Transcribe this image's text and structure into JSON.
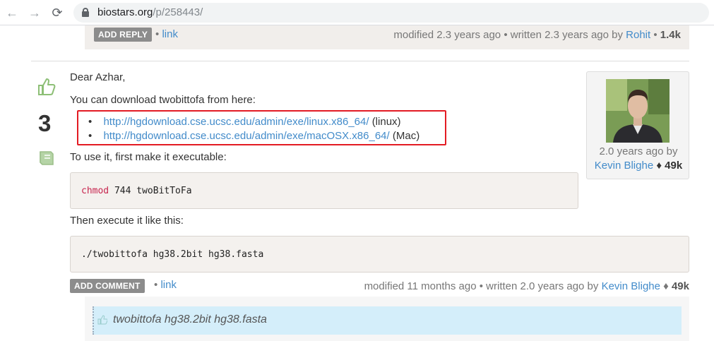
{
  "browser": {
    "url_domain": "biostars.org",
    "url_path": "/p/258443/",
    "back_glyph": "←",
    "forward_glyph": "→",
    "reload_glyph": "⟳"
  },
  "top_reply": {
    "button_label": "ADD REPLY",
    "separator": "•",
    "link_label": "link",
    "modified": "modified 2.3 years ago",
    "written": "• written 2.3 years ago by",
    "author": "Rohit",
    "score": "1.4k",
    "score_sep": "•"
  },
  "answer": {
    "votes": "3",
    "greeting": "Dear Azhar,",
    "intro": "You can download twobittofa from here:",
    "links": [
      {
        "url": "http://hgdownload.cse.ucsc.edu/admin/exe/linux.x86_64/",
        "note": "(linux)"
      },
      {
        "url": "http://hgdownload.cse.ucsc.edu/admin/exe/macOSX.x86_64/",
        "note": "(Mac)"
      }
    ],
    "step1": "To use it, first make it executable:",
    "code1_cmd": "chmod",
    "code1_rest": " 744 twoBitToFa",
    "step2": "Then execute it like this:",
    "code2": "./twobittofa hg38.2bit hg38.fasta",
    "author_card": {
      "ago": "2.0 years ago by",
      "name": "Kevin Blighe",
      "diamond": "♦",
      "score": "49k"
    },
    "add_comment_label": "ADD COMMENT",
    "separator": "•",
    "link_label": "link",
    "modified": "modified 11 months ago",
    "written": "• written 2.0 years ago by",
    "author": "Kevin Blighe",
    "diamond": "♦",
    "score": "49k"
  },
  "comment": {
    "text": "twobittofa hg38.2bit hg38.fasta"
  },
  "colors": {
    "link": "#428bca",
    "highlight_border": "#e31b23",
    "comment_bg": "#d4eefa",
    "vote_icon": "#8dbf76"
  }
}
